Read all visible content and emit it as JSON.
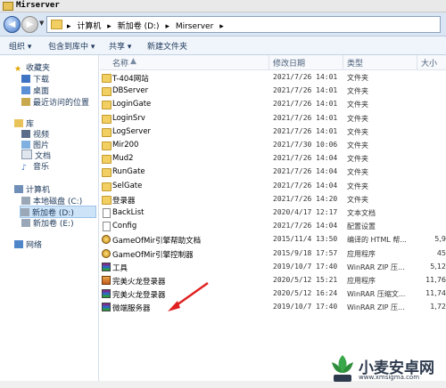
{
  "window": {
    "title": "Mirserver"
  },
  "address": {
    "crumbs": [
      "计算机",
      "▸",
      "新加卷 (D:)",
      "▸",
      "Mirserver",
      "▸"
    ]
  },
  "toolbar": {
    "organize": "组织 ▾",
    "include": "包含到库中 ▾",
    "share": "共享 ▾",
    "new_folder": "新建文件夹"
  },
  "sidebar": {
    "favorites": "收藏夹",
    "downloads": "下载",
    "desktop": "桌面",
    "recent": "最近访问的位置",
    "library": "库",
    "video": "视频",
    "pictures": "图片",
    "documents": "文档",
    "music": "音乐",
    "computer": "计算机",
    "local_c": "本地磁盘 (C:)",
    "new_d": "新加卷 (D:)",
    "new_e": "新加卷 (E:)",
    "network": "网络"
  },
  "columns": {
    "name": "名称",
    "date": "修改日期",
    "type": "类型",
    "size": "大小"
  },
  "files": [
    {
      "name": "T-404网站",
      "date": "2021/7/26 14:01",
      "type": "文件夹",
      "size": "",
      "icon": "folder-icon"
    },
    {
      "name": "DBServer",
      "date": "2021/7/26 14:01",
      "type": "文件夹",
      "size": "",
      "icon": "folder-icon"
    },
    {
      "name": "LoginGate",
      "date": "2021/7/26 14:01",
      "type": "文件夹",
      "size": "",
      "icon": "folder-icon"
    },
    {
      "name": "LoginSrv",
      "date": "2021/7/26 14:01",
      "type": "文件夹",
      "size": "",
      "icon": "folder-icon"
    },
    {
      "name": "LogServer",
      "date": "2021/7/26 14:01",
      "type": "文件夹",
      "size": "",
      "icon": "folder-icon"
    },
    {
      "name": "Mir200",
      "date": "2021/7/30 10:06",
      "type": "文件夹",
      "size": "",
      "icon": "folder-icon"
    },
    {
      "name": "Mud2",
      "date": "2021/7/26 14:04",
      "type": "文件夹",
      "size": "",
      "icon": "folder-icon"
    },
    {
      "name": "RunGate",
      "date": "2021/7/26 14:04",
      "type": "文件夹",
      "size": "",
      "icon": "folder-icon"
    },
    {
      "name": "SelGate",
      "date": "2021/7/26 14:04",
      "type": "文件夹",
      "size": "",
      "icon": "folder-icon"
    },
    {
      "name": "登录器",
      "date": "2021/7/26 14:20",
      "type": "文件夹",
      "size": "",
      "icon": "folder-icon"
    },
    {
      "name": "BackList",
      "date": "2020/4/17 12:17",
      "type": "文本文档",
      "size": "",
      "icon": "document-icon"
    },
    {
      "name": "Config",
      "date": "2021/7/26 14:04",
      "type": "配置设置",
      "size": "",
      "icon": "settings-file-icon"
    },
    {
      "name": "GameOfMir引擎帮助文档",
      "date": "2015/11/4 13:50",
      "type": "编译的 HTML 帮...",
      "size": "5,9",
      "icon": "help-file-icon"
    },
    {
      "name": "GameOfMir引擎控制器",
      "date": "2015/9/18 17:57",
      "type": "应用程序",
      "size": "45",
      "icon": "game-app-icon"
    },
    {
      "name": "工具",
      "date": "2019/10/7 17:40",
      "type": "WinRAR ZIP 压...",
      "size": "5,12",
      "icon": "winrar-icon"
    },
    {
      "name": "完美火龙登录器",
      "date": "2020/5/12 15:21",
      "type": "应用程序",
      "size": "11,76",
      "icon": "app-icon"
    },
    {
      "name": "完美火龙登录器",
      "date": "2020/5/12 16:24",
      "type": "WinRAR 压缩文...",
      "size": "11,74",
      "icon": "winrar-icon"
    },
    {
      "name": "微端服务器",
      "date": "2019/10/7 17:40",
      "type": "WinRAR ZIP 压...",
      "size": "1,72",
      "icon": "winrar-icon"
    }
  ],
  "watermark": {
    "text": "小麦安卓网",
    "sub": "www.xmsigma.com"
  }
}
